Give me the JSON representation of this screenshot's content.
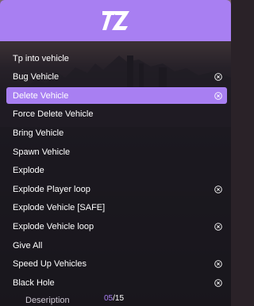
{
  "header": {
    "logo_text": "TZ",
    "accent": "#a87ff2"
  },
  "menu": {
    "items": [
      {
        "label": "Tp into vehicle",
        "has_close": false,
        "active": false
      },
      {
        "label": "Bug Vehicle",
        "has_close": true,
        "active": false
      },
      {
        "label": "Delete Vehicle",
        "has_close": true,
        "active": true
      },
      {
        "label": "Force Delete Vehicle",
        "has_close": false,
        "active": false
      },
      {
        "label": "Bring Vehicle",
        "has_close": false,
        "active": false
      },
      {
        "label": "Spawn Vehicle",
        "has_close": false,
        "active": false
      },
      {
        "label": "Explode",
        "has_close": false,
        "active": false
      },
      {
        "label": "Explode Player loop",
        "has_close": true,
        "active": false
      },
      {
        "label": "Explode Vehicle [SAFE]",
        "has_close": false,
        "active": false
      },
      {
        "label": "Explode Vehicle loop",
        "has_close": true,
        "active": false
      },
      {
        "label": "Give All",
        "has_close": false,
        "active": false
      },
      {
        "label": "Speed Up Vehicles",
        "has_close": true,
        "active": false
      },
      {
        "label": "Black Hole",
        "has_close": true,
        "active": false
      }
    ]
  },
  "footer": {
    "description": "Deseription",
    "page_current": "05",
    "page_sep": "/",
    "page_total": "15"
  }
}
